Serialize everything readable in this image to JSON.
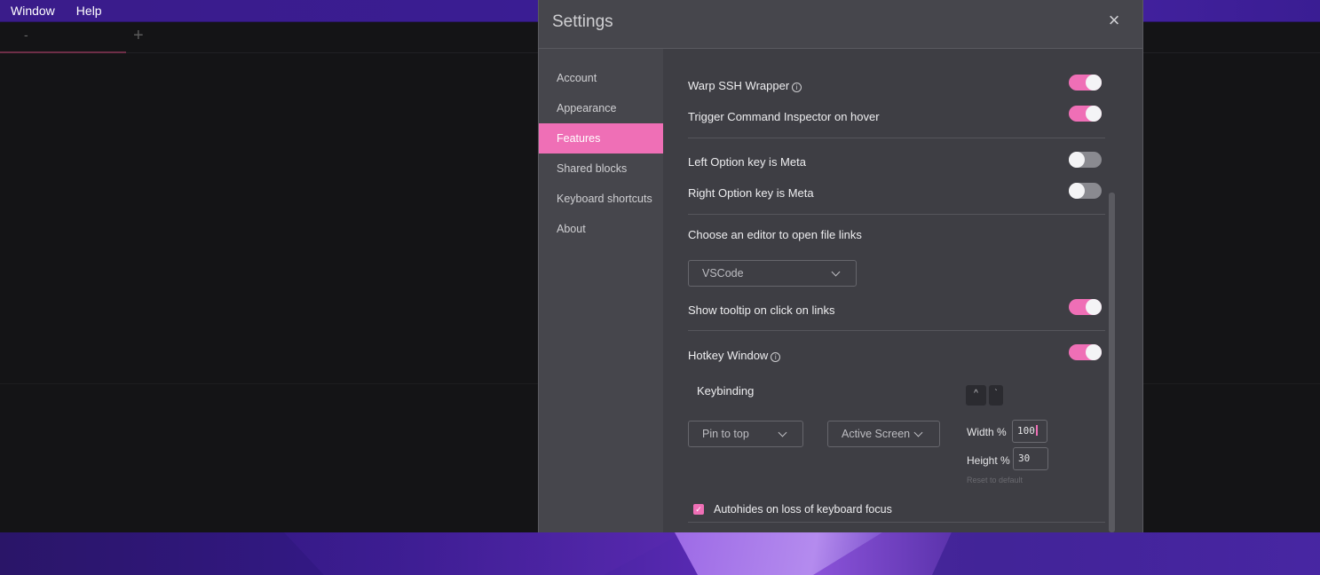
{
  "menubar": {
    "items": [
      "Window",
      "Help"
    ]
  },
  "terminal": {
    "tab_title": "-",
    "new_tab_glyph": "+"
  },
  "modal": {
    "title": "Settings",
    "close_glyph": "×",
    "nav": [
      {
        "label": "Account",
        "active": false
      },
      {
        "label": "Appearance",
        "active": false
      },
      {
        "label": "Features",
        "active": true
      },
      {
        "label": "Shared blocks",
        "active": false
      },
      {
        "label": "Keyboard shortcuts",
        "active": false
      },
      {
        "label": "About",
        "active": false
      }
    ],
    "features": {
      "warp_ssh_wrapper": {
        "label": "Warp SSH Wrapper",
        "enabled": true
      },
      "trigger_inspector": {
        "label": "Trigger Command Inspector on hover",
        "enabled": true
      },
      "left_option_meta": {
        "label": "Left Option key is Meta",
        "enabled": false
      },
      "right_option_meta": {
        "label": "Right Option key is Meta",
        "enabled": false
      },
      "editor_label": "Choose an editor to open file links",
      "editor_value": "VSCode",
      "tooltip_on_click": {
        "label": "Show tooltip on click on links",
        "enabled": true
      },
      "hotkey_window": {
        "label": "Hotkey Window",
        "enabled": true
      },
      "keybinding_label": "Keybinding",
      "keybinding_keys": [
        "^",
        "`"
      ],
      "pin_value": "Pin to top",
      "screen_value": "Active Screen",
      "width_label": "Width %",
      "width_value": "100",
      "height_label": "Height %",
      "height_value": "30",
      "reset_label": "Reset to default",
      "autohide": {
        "label": "Autohides on loss of keyboard focus",
        "checked": true
      }
    }
  },
  "colors": {
    "accent": "#ef6fb6",
    "menubar": "#3a1c8a",
    "panel": "#3e3e44",
    "sidebar": "#46464c"
  },
  "icons": [
    "info-icon",
    "close-icon",
    "chevron-down-icon",
    "check-icon",
    "plus-icon"
  ]
}
